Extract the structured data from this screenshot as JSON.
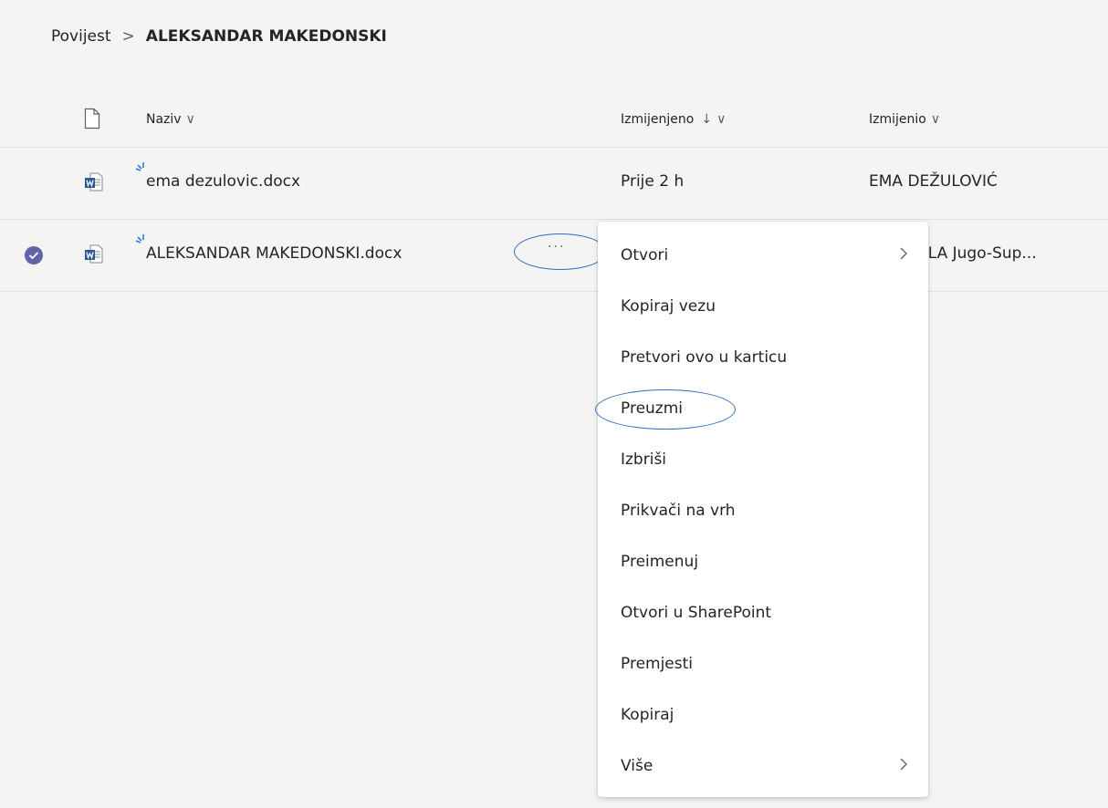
{
  "breadcrumb": {
    "root": "Povijest",
    "separator": ">",
    "current": "ALEKSANDAR MAKEDONSKI"
  },
  "columns": {
    "name": "Naziv",
    "modified": "Izmijenjeno",
    "modified_sort_arrow": "↓",
    "modified_by": "Izmijenio",
    "chevron": "∨"
  },
  "files": [
    {
      "name": "ema dezulovic.docx",
      "modified": "Prije 2 h",
      "modified_by": "EMA DEŽULOVIĆ",
      "selected": false
    },
    {
      "name": "ALEKSANDAR MAKEDONSKI.docx",
      "modified": "",
      "modified_by": "ELA Jugo-Sup...",
      "selected": true
    }
  ],
  "more_button": "···",
  "context_menu": {
    "items": [
      {
        "label": "Otvori",
        "submenu": true
      },
      {
        "label": "Kopiraj vezu",
        "submenu": false
      },
      {
        "label": "Pretvori ovo u karticu",
        "submenu": false
      },
      {
        "label": "Preuzmi",
        "submenu": false,
        "highlighted": true
      },
      {
        "label": "Izbriši",
        "submenu": false
      },
      {
        "label": "Prikvači na vrh",
        "submenu": false
      },
      {
        "label": "Preimenuj",
        "submenu": false
      },
      {
        "label": "Otvori u SharePoint",
        "submenu": false
      },
      {
        "label": "Premjesti",
        "submenu": false
      },
      {
        "label": "Kopiraj",
        "submenu": false
      },
      {
        "label": "Više",
        "submenu": true
      }
    ]
  },
  "colors": {
    "accent": "#6264a7",
    "word_blue": "#2b579a",
    "annotation_blue": "#2e6dbd",
    "background": "#f5f4f2"
  },
  "icons": {
    "file_header": "file-icon",
    "document": "word-document-icon",
    "recent_edit": "recent-edit-spark-icon",
    "selected": "checkmark-circle-icon",
    "submenu": "chevron-right-icon"
  }
}
